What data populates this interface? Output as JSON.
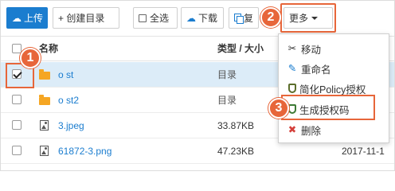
{
  "toolbar": {
    "upload_label": "上传",
    "create_dir_label": "+ 创建目录",
    "select_all_label": "全选",
    "download_label": "下载",
    "copy_label": "复",
    "more_label": "更多"
  },
  "table": {
    "headers": {
      "name": "名称",
      "type_size": "类型 / 大小"
    },
    "rows": [
      {
        "name": "o     st",
        "meta": "目录",
        "date": "",
        "checked": true,
        "kind": "folder"
      },
      {
        "name": "o     st2",
        "meta": "目录",
        "date": "",
        "checked": false,
        "kind": "folder"
      },
      {
        "name": "3.jpeg",
        "meta": "33.87KB",
        "date": "",
        "checked": false,
        "kind": "image"
      },
      {
        "name": "61872-3.png",
        "meta": "47.23KB",
        "date": "2017-11-1",
        "checked": false,
        "kind": "image"
      }
    ]
  },
  "menu": {
    "items": [
      {
        "label": "移动",
        "icon": "scissors-icon"
      },
      {
        "label": "重命名",
        "icon": "edit-icon"
      },
      {
        "label": "简化Policy授权",
        "icon": "shield-icon"
      },
      {
        "label": "生成授权码",
        "icon": "shield-icon"
      },
      {
        "label": "删除",
        "icon": "close-icon"
      }
    ]
  },
  "callouts": {
    "one": "1",
    "two": "2",
    "three": "3"
  },
  "colors": {
    "primary": "#1b7dcf",
    "callout": "#e7663a",
    "selected_row": "#dcecf8",
    "folder": "#f5a623"
  }
}
